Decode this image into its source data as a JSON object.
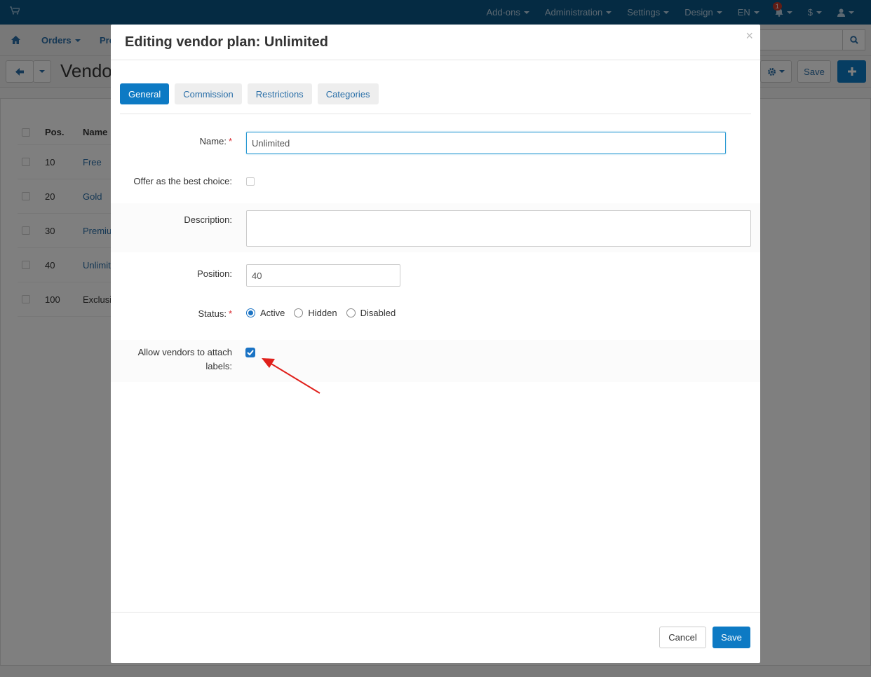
{
  "topnav": {
    "items": [
      "Add-ons",
      "Administration",
      "Settings",
      "Design",
      "EN"
    ],
    "notifications_count": "1",
    "currency": "$"
  },
  "subnav": {
    "orders": "Orders",
    "products_partial": "Pro"
  },
  "toolbar": {
    "page_title_partial": "Vendor",
    "save_label": "Save"
  },
  "background_table": {
    "headers": {
      "pos": "Pos.",
      "name": "Name"
    },
    "rows": [
      {
        "pos": "10",
        "name": "Free"
      },
      {
        "pos": "20",
        "name": "Gold"
      },
      {
        "pos": "30",
        "name": "Premiu"
      },
      {
        "pos": "40",
        "name": "Unlimit"
      },
      {
        "pos": "100",
        "name": "Exclusi"
      }
    ]
  },
  "modal": {
    "title": "Editing vendor plan: Unlimited",
    "close": "×",
    "tabs": [
      "General",
      "Commission",
      "Restrictions",
      "Categories"
    ],
    "form": {
      "name_label": "Name:",
      "name_value": "Unlimited",
      "best_choice_label": "Offer as the best choice:",
      "description_label": "Description:",
      "description_value": "",
      "position_label": "Position:",
      "position_value": "40",
      "status_label": "Status:",
      "status_options": [
        "Active",
        "Hidden",
        "Disabled"
      ],
      "status_selected": "Active",
      "labels_label_line1": "Allow vendors to attach",
      "labels_label_line2": "labels:",
      "labels_checked": true
    },
    "cancel_label": "Cancel",
    "save_label": "Save"
  },
  "colors": {
    "primary": "#0d7ac4",
    "topbar": "#0a5686",
    "annotation_arrow": "#e0201b"
  }
}
